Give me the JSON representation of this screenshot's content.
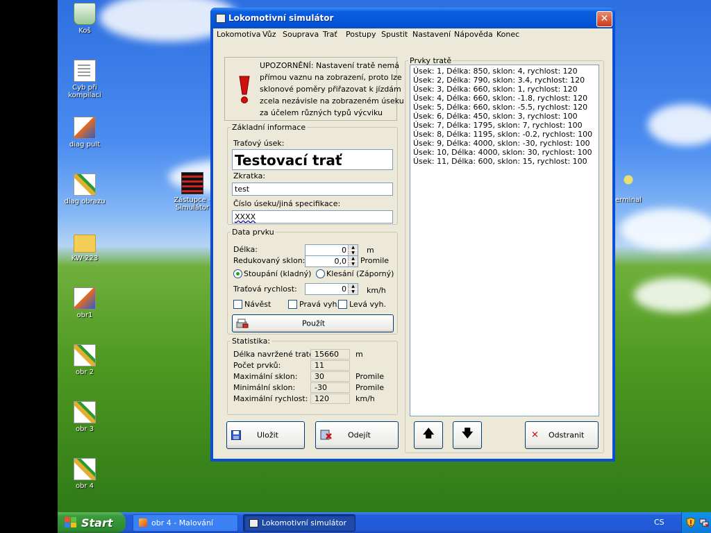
{
  "desktop": {
    "icons": [
      {
        "label": "Koš"
      },
      {
        "label": "Cyb při kompilaci"
      },
      {
        "label": "diag pult"
      },
      {
        "label": "diag obrazu"
      },
      {
        "label": "KW-223"
      },
      {
        "label": "obr1"
      },
      {
        "label": "obr 2"
      },
      {
        "label": "obr 3"
      },
      {
        "label": "obr 4"
      },
      {
        "label": "Zástupce - Simulátor"
      },
      {
        "label": "erminal"
      }
    ]
  },
  "window": {
    "title": "Lokomotivní simulátor",
    "close_symbol": "✕",
    "menu": [
      "Lokomotiva",
      "Vůz",
      "Souprava",
      "Trať",
      "Postupy",
      "Spustit",
      "Nastavení",
      "Nápověda",
      "Konec"
    ]
  },
  "warning": {
    "text_lines": [
      "UPOZORNĚNÍ: Nastavení tratě nemá",
      "přímou vaznu na zobrazení, proto lze",
      "sklonové poměry přiřazovat k jízdám",
      "zcela nezávisle na zobrazeném úseku",
      "za účelem různých typů výcviku"
    ]
  },
  "basic_info": {
    "legend": "Základní informace",
    "track_label": "Traťový úsek:",
    "track_value": "Testovací trať",
    "abbr_label": "Zkratka:",
    "abbr_value": "test",
    "spec_label": "Číslo úseku/jiná specifikace:",
    "spec_value": "XXXX"
  },
  "element_data": {
    "legend": "Data prvku",
    "length_label": "Délka:",
    "length_value": "0",
    "length_unit": "m",
    "slope_label": "Redukovaný sklon:",
    "slope_value": "0,0",
    "slope_unit": "Promile",
    "radio_up": "Stoupání (kladný)",
    "radio_down": "Klesání (Záporný)",
    "radio_selected": "up",
    "speed_label": "Traťová rychlost:",
    "speed_value": "0",
    "speed_unit": "km/h",
    "check_signal": "Návěst",
    "check_right": "Pravá vyh.",
    "check_left": "Levá vyh.",
    "apply_label": "Použít"
  },
  "stats": {
    "legend": "Statistika:",
    "rows": [
      {
        "label": "Délka navržené tratě:",
        "value": "15660",
        "unit": "m"
      },
      {
        "label": "Počet prvků:",
        "value": "11",
        "unit": ""
      },
      {
        "label": "Maximální sklon:",
        "value": "30",
        "unit": "Promile"
      },
      {
        "label": "Minimální sklon:",
        "value": "-30",
        "unit": "Promile"
      },
      {
        "label": "Maximální rychlost:",
        "value": "120",
        "unit": "km/h"
      }
    ]
  },
  "buttons": {
    "save": "Uložit",
    "leave": "Odejít",
    "remove": "Odstranit",
    "remove_symbol": "✕",
    "up_symbol": "🡅",
    "down_symbol": "🡇"
  },
  "track_elements": {
    "legend": "Prvky tratě",
    "items": [
      "Úsek:  1,   Délka:  850,   sklon:  4,   rychlost:  120",
      "Úsek:  2,   Délka:  790,   sklon:  3.4,   rychlost:  120",
      "Úsek:  3,   Délka:  660,   sklon:  1,   rychlost:  120",
      "Úsek:  4,   Délka:  660,   sklon:  -1.8,   rychlost:  120",
      "Úsek:  5,   Délka:  660,   sklon:  -5.5,   rychlost:  120",
      "Úsek:  6,   Délka:  450,   sklon:  3,   rychlost:  100",
      "Úsek:  7,   Délka:  1795,   sklon:  7,   rychlost:  100",
      "Úsek:  8,   Délka:  1195,   sklon:  -0.2,   rychlost:  100",
      "Úsek:  9,   Délka:  4000,   sklon:  -30,   rychlost:  100",
      "Úsek:  10,   Délka:  4000,   sklon:  30,   rychlost:  100",
      "Úsek:  11,   Délka:  600,   sklon:  15,   rychlost:  100"
    ]
  },
  "taskbar": {
    "start": "Start",
    "tasks": [
      "obr 4 - Malování",
      "Lokomotivní simulátor"
    ],
    "lang": "CS"
  },
  "colors": {
    "window_frame": "#0a4ed8",
    "dialog_bg": "#ece9d8",
    "warning_red": "#d01010",
    "taskbar": "#245edb",
    "start_green": "#3c9a3c"
  }
}
